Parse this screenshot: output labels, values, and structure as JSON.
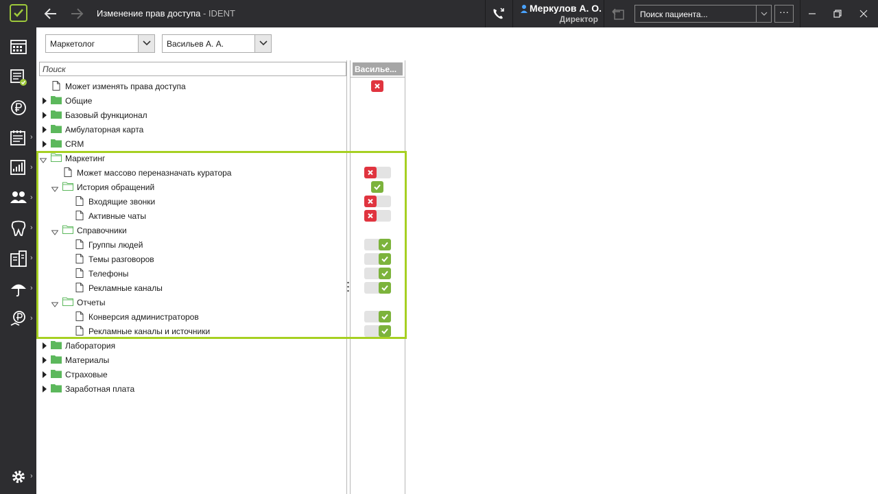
{
  "window": {
    "title": "Изменение прав доступа",
    "app_suffix": " - IDENT",
    "user_name": "Меркулов А. О.",
    "user_role": "Директор",
    "search_placeholder": "Поиск пациента...",
    "more_label": "···"
  },
  "sidebar": {
    "items": [
      "schedule-icon",
      "tasks-icon",
      "finance-icon",
      "documents-icon",
      "reports-icon",
      "patients-icon",
      "tooth-icon",
      "lab-icon",
      "insurance-icon",
      "salary-icon"
    ],
    "settings_icon": "gear-icon"
  },
  "filters": {
    "role": "Маркетолог",
    "employee": "Васильев А. А."
  },
  "tree": {
    "search_placeholder": "Поиск",
    "column_header": "Васильев А. А.",
    "column_header_short": "Василье...",
    "rows": [
      {
        "label": "Может изменять права доступа",
        "kind": "file",
        "state": "red"
      },
      {
        "label": "Общие",
        "kind": "folder",
        "state": ""
      },
      {
        "label": "Базовый функционал",
        "kind": "folder",
        "state": ""
      },
      {
        "label": "Амбулаторная карта",
        "kind": "folder",
        "state": ""
      },
      {
        "label": "CRM",
        "kind": "folder",
        "state": ""
      },
      {
        "label": "Маркетинг",
        "kind": "folder-open",
        "state": ""
      },
      {
        "label": "Может массово переназначать куратора",
        "kind": "file",
        "state": "off"
      },
      {
        "label": "История обращений",
        "kind": "folder-open",
        "state": "green"
      },
      {
        "label": "Входящие звонки",
        "kind": "file",
        "state": "off"
      },
      {
        "label": "Активные чаты",
        "kind": "file",
        "state": "off"
      },
      {
        "label": "Справочники",
        "kind": "folder-open",
        "state": ""
      },
      {
        "label": "Группы людей",
        "kind": "file",
        "state": "on"
      },
      {
        "label": "Темы разговоров",
        "kind": "file",
        "state": "on"
      },
      {
        "label": "Телефоны",
        "kind": "file",
        "state": "on"
      },
      {
        "label": "Рекламные каналы",
        "kind": "file",
        "state": "on"
      },
      {
        "label": "Отчеты",
        "kind": "folder-open",
        "state": ""
      },
      {
        "label": "Конверсия администраторов",
        "kind": "file",
        "state": "on"
      },
      {
        "label": "Рекламные каналы и источники",
        "kind": "file",
        "state": "on"
      },
      {
        "label": "Лаборатория",
        "kind": "folder",
        "state": ""
      },
      {
        "label": "Материалы",
        "kind": "folder",
        "state": ""
      },
      {
        "label": "Страховые",
        "kind": "folder",
        "state": ""
      },
      {
        "label": "Заработная плата",
        "kind": "folder",
        "state": ""
      }
    ]
  },
  "colors": {
    "accent": "#a6d022",
    "deny": "#e0343f",
    "allow": "#7cb33c",
    "folder": "#5cb85c",
    "chrome": "#2d2d30"
  }
}
